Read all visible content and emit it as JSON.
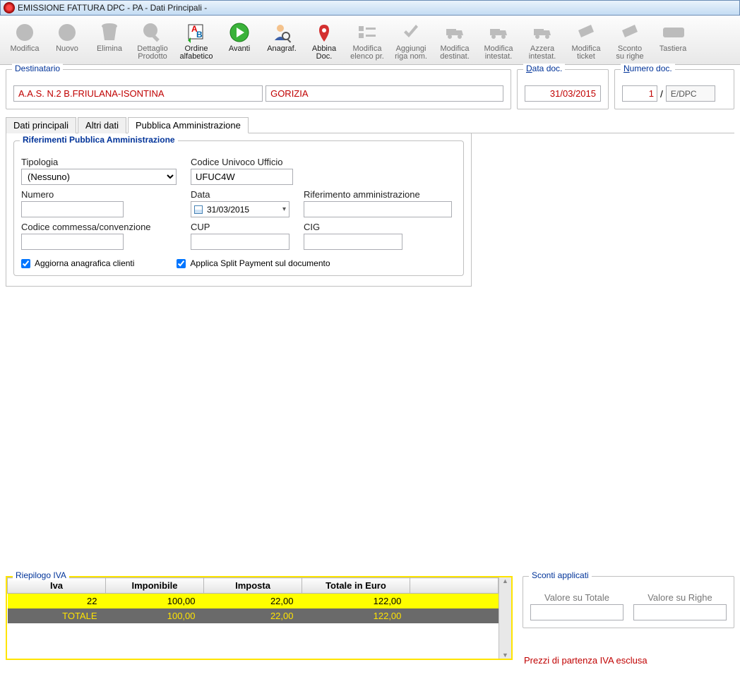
{
  "window": {
    "title": "EMISSIONE  FATTURA DPC - PA  - Dati Principali -"
  },
  "toolbar": {
    "modifica": "Modifica",
    "nuovo": "Nuovo",
    "elimina": "Elimina",
    "dettaglio": "Dettaglio\nProdotto",
    "ordine": "Ordine\nalfabetico",
    "avanti": "Avanti",
    "anagraf": "Anagraf.",
    "abbina": "Abbina\nDoc.",
    "modelenco": "Modifica\nelenco pr.",
    "aggiungi": "Aggiungi\nriga nom.",
    "moddest": "Modifica\ndestinat.",
    "modint": "Modifica\nintestat.",
    "azzera": "Azzera\nintestat.",
    "ticket": "Modifica\nticket",
    "sconto": "Sconto\nsu righe",
    "tastiera": "Tastiera"
  },
  "dest": {
    "legend": "Destinatario",
    "name": "A.A.S. N.2 B.FRIULANA-ISONTINA",
    "city": "GORIZIA"
  },
  "datadoc": {
    "legend": "Data doc.",
    "value": "31/03/2015"
  },
  "numdoc": {
    "legend": "Numero doc.",
    "value": "1",
    "serie": "E/DPC"
  },
  "tabs": {
    "t1": "Dati principali",
    "t2": "Altri dati",
    "t3": "Pubblica Amministrazione"
  },
  "pa": {
    "legend": "Riferimenti Pubblica Amministrazione",
    "tipologia_label": "Tipologia",
    "tipologia_value": "(Nessuno)",
    "codice_label": "Codice Univoco Ufficio",
    "codice_value": "UFUC4W",
    "numero_label": "Numero",
    "numero_value": "",
    "data_label": "Data",
    "data_value": "31/03/2015",
    "rif_label": "Riferimento amministrazione",
    "rif_value": "",
    "commessa_label": "Codice commessa/convenzione",
    "commessa_value": "",
    "cup_label": "CUP",
    "cup_value": "",
    "cig_label": "CIG",
    "cig_value": "",
    "chk1": "Aggiorna anagrafica clienti",
    "chk2": "Applica Split Payment sul documento"
  },
  "iva": {
    "legend": "Riepilogo IVA",
    "headers": {
      "h1": "Iva",
      "h2": "Imponibile",
      "h3": "Imposta",
      "h4": "Totale in Euro"
    },
    "row": {
      "c1": "22",
      "c2": "100,00",
      "c3": "22,00",
      "c4": "122,00"
    },
    "total": {
      "c1": "TOTALE",
      "c2": "100,00",
      "c3": "22,00",
      "c4": "122,00"
    }
  },
  "sconti": {
    "legend": "Sconti applicati",
    "l1": "Valore su Totale",
    "l2": "Valore su Righe"
  },
  "note": "Prezzi di partenza IVA esclusa"
}
